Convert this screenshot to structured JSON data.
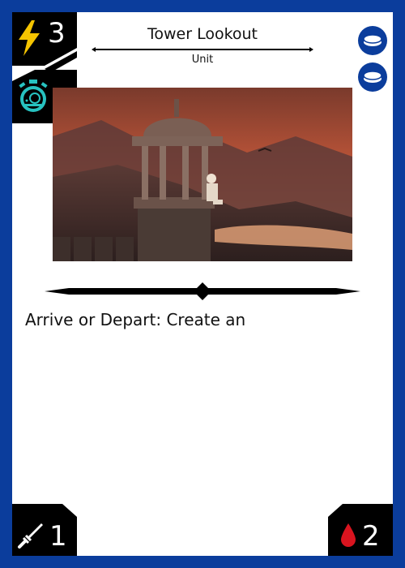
{
  "card": {
    "title": "Tower Lookout",
    "type_line": "Unit",
    "rules_text": "Arrive or Depart: Create an",
    "cost": "3",
    "power": "1",
    "health": "2"
  },
  "icons": {
    "cost": "lightning-icon",
    "speed": "stopwatch-snail-icon",
    "tokens": [
      "token-icon",
      "token-icon"
    ],
    "power": "sword-icon",
    "health": "blood-drop-icon"
  },
  "colors": {
    "frame": "#0b3d9c",
    "badge": "#000000",
    "lightning": "#f5c400",
    "speed": "#27c2c0",
    "health": "#d9141f",
    "power": "#ffffff"
  }
}
